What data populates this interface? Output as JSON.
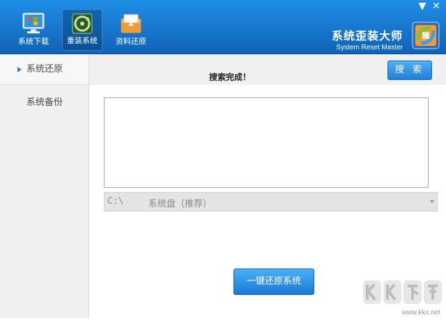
{
  "header": {
    "nav": [
      {
        "label": "系统下载",
        "icon": "monitor-windows-icon"
      },
      {
        "label": "重装系统",
        "icon": "reinstall-disc-icon"
      },
      {
        "label": "资料还原",
        "icon": "folder-restore-icon"
      }
    ],
    "active_nav": 1,
    "brand_cn": "系统歪装大师",
    "brand_en": "System Reset Master",
    "window_buttons": {
      "menu": "▼",
      "close": "✕"
    }
  },
  "sidebar": {
    "items": [
      {
        "label": "系统还原",
        "active": true
      },
      {
        "label": "系统备份",
        "active": false
      }
    ]
  },
  "main": {
    "status": "搜索完成！",
    "search_label": "搜 索",
    "combo": {
      "drive": "C:\\",
      "label": "系统盘（推荐）"
    },
    "restore_label": "一键还原系统"
  },
  "watermark": {
    "text": "www.kkx.net"
  },
  "colors": {
    "header": "#1676cc",
    "accent": "#1f7fd6",
    "sidebar": "#f0f0f0"
  }
}
